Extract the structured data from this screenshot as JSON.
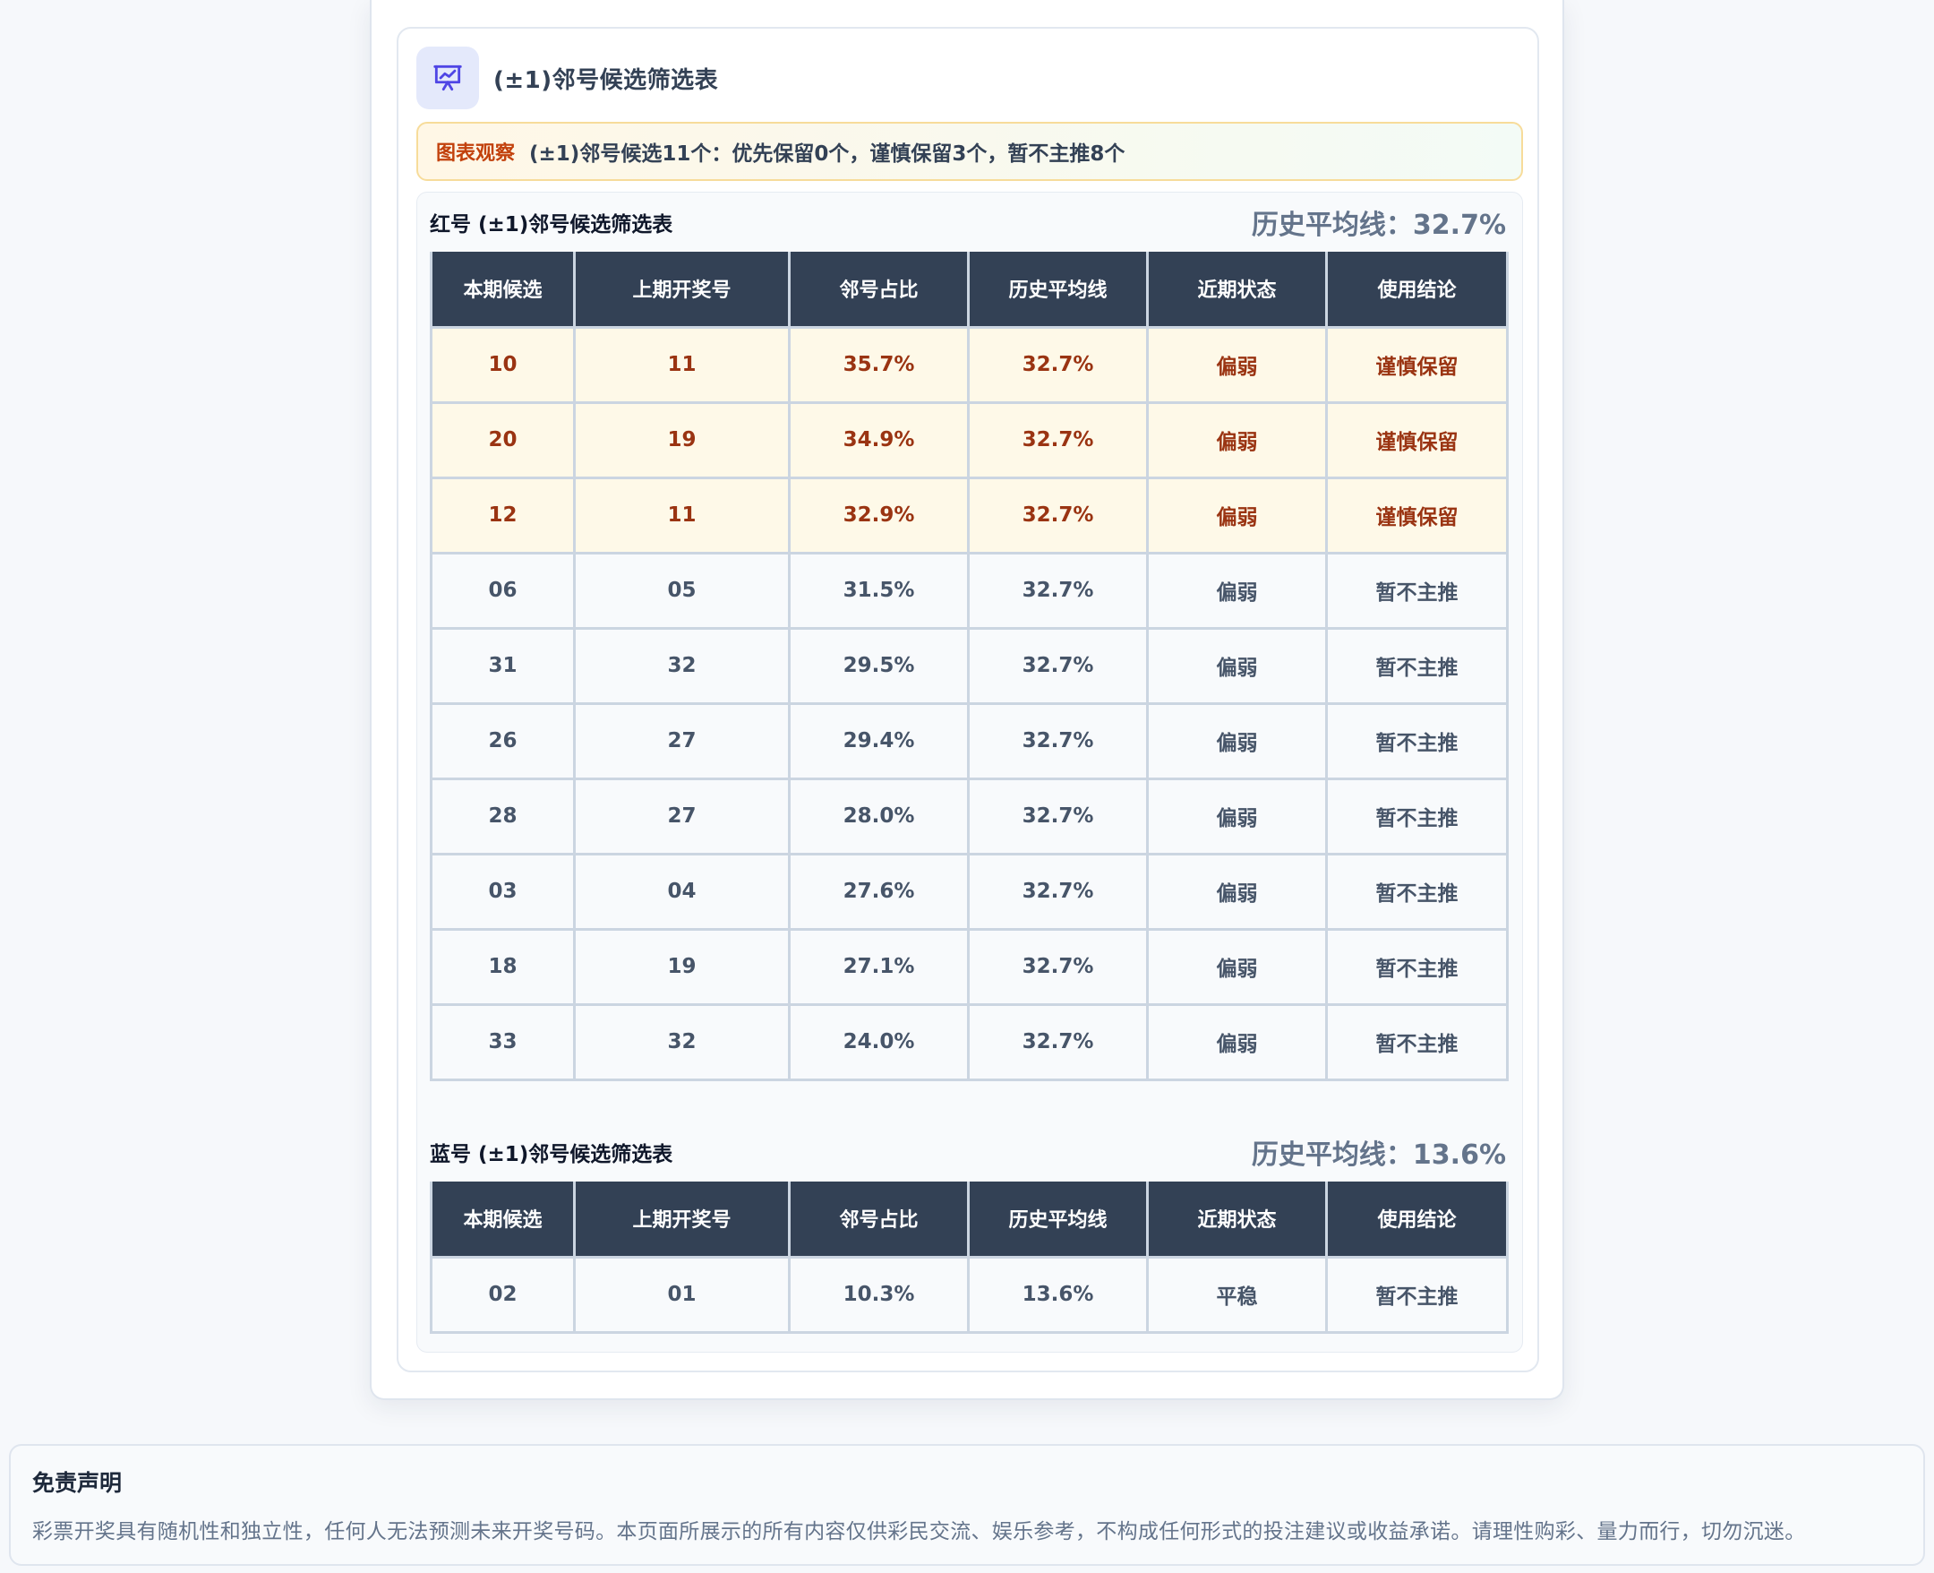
{
  "card": {
    "title": "(±1)邻号候选筛选表",
    "observation_label": "图表观察",
    "observation_text": "(±1)邻号候选11个：优先保留0个，谨慎保留3个，暂不主推8个"
  },
  "columns": [
    "本期候选",
    "上期开奖号",
    "邻号占比",
    "历史平均线",
    "近期状态",
    "使用结论"
  ],
  "red": {
    "title": "红号 (±1)邻号候选筛选表",
    "avg_label": "历史平均线：32.7%",
    "rows": [
      {
        "candidate": "10",
        "last": "11",
        "ratio": "35.7%",
        "avg": "32.7%",
        "status": "偏弱",
        "conclusion": "谨慎保留",
        "highlight": true
      },
      {
        "candidate": "20",
        "last": "19",
        "ratio": "34.9%",
        "avg": "32.7%",
        "status": "偏弱",
        "conclusion": "谨慎保留",
        "highlight": true
      },
      {
        "candidate": "12",
        "last": "11",
        "ratio": "32.9%",
        "avg": "32.7%",
        "status": "偏弱",
        "conclusion": "谨慎保留",
        "highlight": true
      },
      {
        "candidate": "06",
        "last": "05",
        "ratio": "31.5%",
        "avg": "32.7%",
        "status": "偏弱",
        "conclusion": "暂不主推",
        "highlight": false
      },
      {
        "candidate": "31",
        "last": "32",
        "ratio": "29.5%",
        "avg": "32.7%",
        "status": "偏弱",
        "conclusion": "暂不主推",
        "highlight": false
      },
      {
        "candidate": "26",
        "last": "27",
        "ratio": "29.4%",
        "avg": "32.7%",
        "status": "偏弱",
        "conclusion": "暂不主推",
        "highlight": false
      },
      {
        "candidate": "28",
        "last": "27",
        "ratio": "28.0%",
        "avg": "32.7%",
        "status": "偏弱",
        "conclusion": "暂不主推",
        "highlight": false
      },
      {
        "candidate": "03",
        "last": "04",
        "ratio": "27.6%",
        "avg": "32.7%",
        "status": "偏弱",
        "conclusion": "暂不主推",
        "highlight": false
      },
      {
        "candidate": "18",
        "last": "19",
        "ratio": "27.1%",
        "avg": "32.7%",
        "status": "偏弱",
        "conclusion": "暂不主推",
        "highlight": false
      },
      {
        "candidate": "33",
        "last": "32",
        "ratio": "24.0%",
        "avg": "32.7%",
        "status": "偏弱",
        "conclusion": "暂不主推",
        "highlight": false
      }
    ]
  },
  "blue": {
    "title": "蓝号 (±1)邻号候选筛选表",
    "avg_label": "历史平均线：13.6%",
    "rows": [
      {
        "candidate": "02",
        "last": "01",
        "ratio": "10.3%",
        "avg": "13.6%",
        "status": "平稳",
        "conclusion": "暂不主推",
        "highlight": false
      }
    ]
  },
  "disclaimer": {
    "title": "免责声明",
    "text": "彩票开奖具有随机性和独立性，任何人无法预测未来开奖号码。本页面所展示的所有内容仅供彩民交流、娱乐参考，不构成任何形式的投注建议或收益承诺。请理性购彩、量力而行，切勿沉迷。"
  },
  "colors": {
    "header_bg": "#334155",
    "highlight_bg": "#fef9e8",
    "highlight_text": "#9a3412",
    "observe_label": "#c2410c",
    "icon_bg": "#e4e9fb",
    "icon_stroke": "#4f46e5"
  },
  "icons": {
    "card_icon": "presentation-chart-icon"
  }
}
